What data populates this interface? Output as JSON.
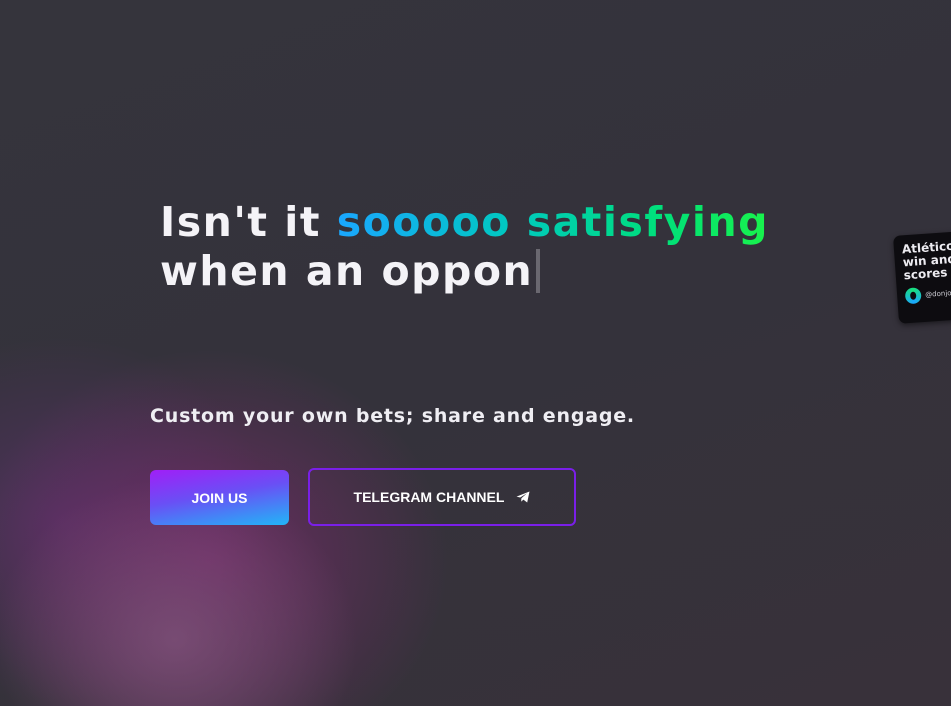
{
  "hero": {
    "headline_part1": "Isn't it ",
    "headline_highlight": "sooooo satisfying",
    "headline_line2": "when an oppon",
    "subtitle": "Custom your own bets; share and engage."
  },
  "buttons": {
    "join_label": "JOIN US",
    "telegram_label": "TELEGRAM CHANNEL",
    "telegram_icon": "paper-plane-icon"
  },
  "card": {
    "text": "Atlético\nwin and\nscores",
    "handle": "@donjoe"
  },
  "colors": {
    "background": "#34323b",
    "highlight_gradient_start": "#1aa7ff",
    "highlight_gradient_end": "#19f24b",
    "join_gradient_start": "#a01ff7",
    "join_gradient_end": "#21b6f7",
    "telegram_border": "#7a1fe8"
  }
}
